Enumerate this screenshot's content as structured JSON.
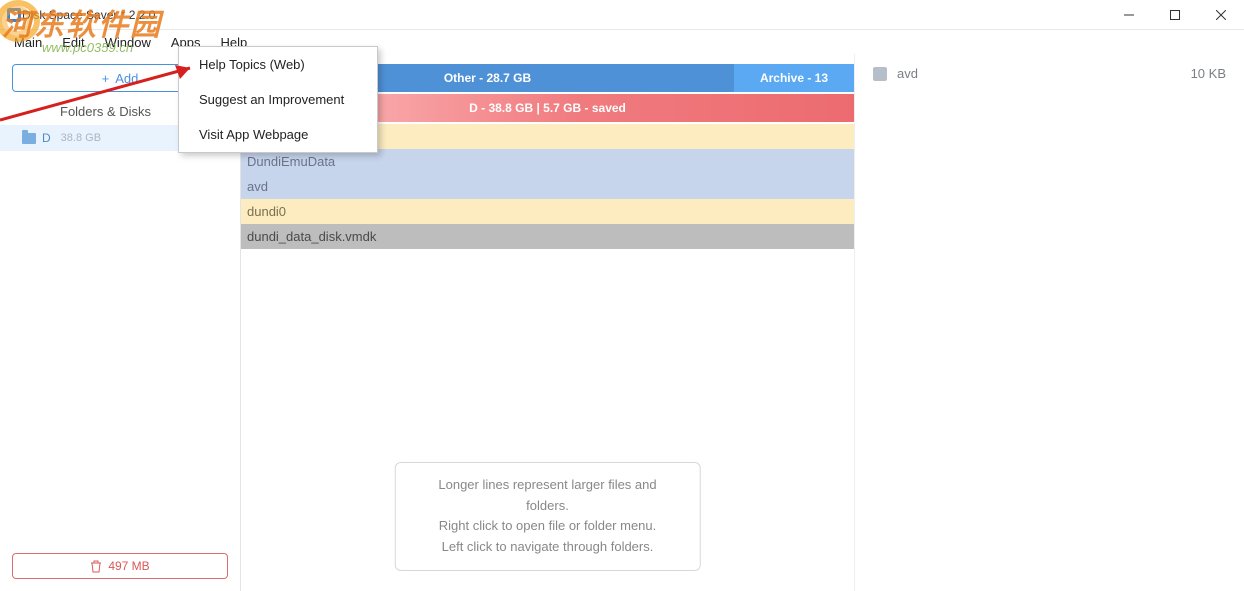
{
  "window": {
    "title": "Disk Space Saver * 2.2.0"
  },
  "menu": {
    "main": "Main",
    "edit": "Edit",
    "window": "Window",
    "apps": "Apps",
    "help": "Help"
  },
  "help_menu": {
    "topics": "Help Topics (Web)",
    "suggest": "Suggest an Improvement",
    "webpage": "Visit App Webpage"
  },
  "sidebar": {
    "add_label": "Add",
    "section": "Folders & Disks",
    "disk": {
      "name": "D",
      "size": "38.8 GB"
    },
    "trash": "497 MB"
  },
  "categories": {
    "other": "Other - 28.7 GB",
    "archive": "Archive - 13"
  },
  "disk_bar": "D - 38.8 GB   |   5.7 GB - saved",
  "files": {
    "r0": "DundiEmuData",
    "r1": "avd",
    "r2": "dundi0",
    "r3": "dundi_data_disk.vmdk"
  },
  "hints": {
    "l1": "Longer lines represent larger files and folders.",
    "l2": "Right click to open file or folder menu.",
    "l3": "Left click to navigate through folders."
  },
  "right": {
    "name": "avd",
    "size": "10 KB"
  },
  "watermark": {
    "text": "河东软件园",
    "url": "www.pc0359.cn"
  }
}
